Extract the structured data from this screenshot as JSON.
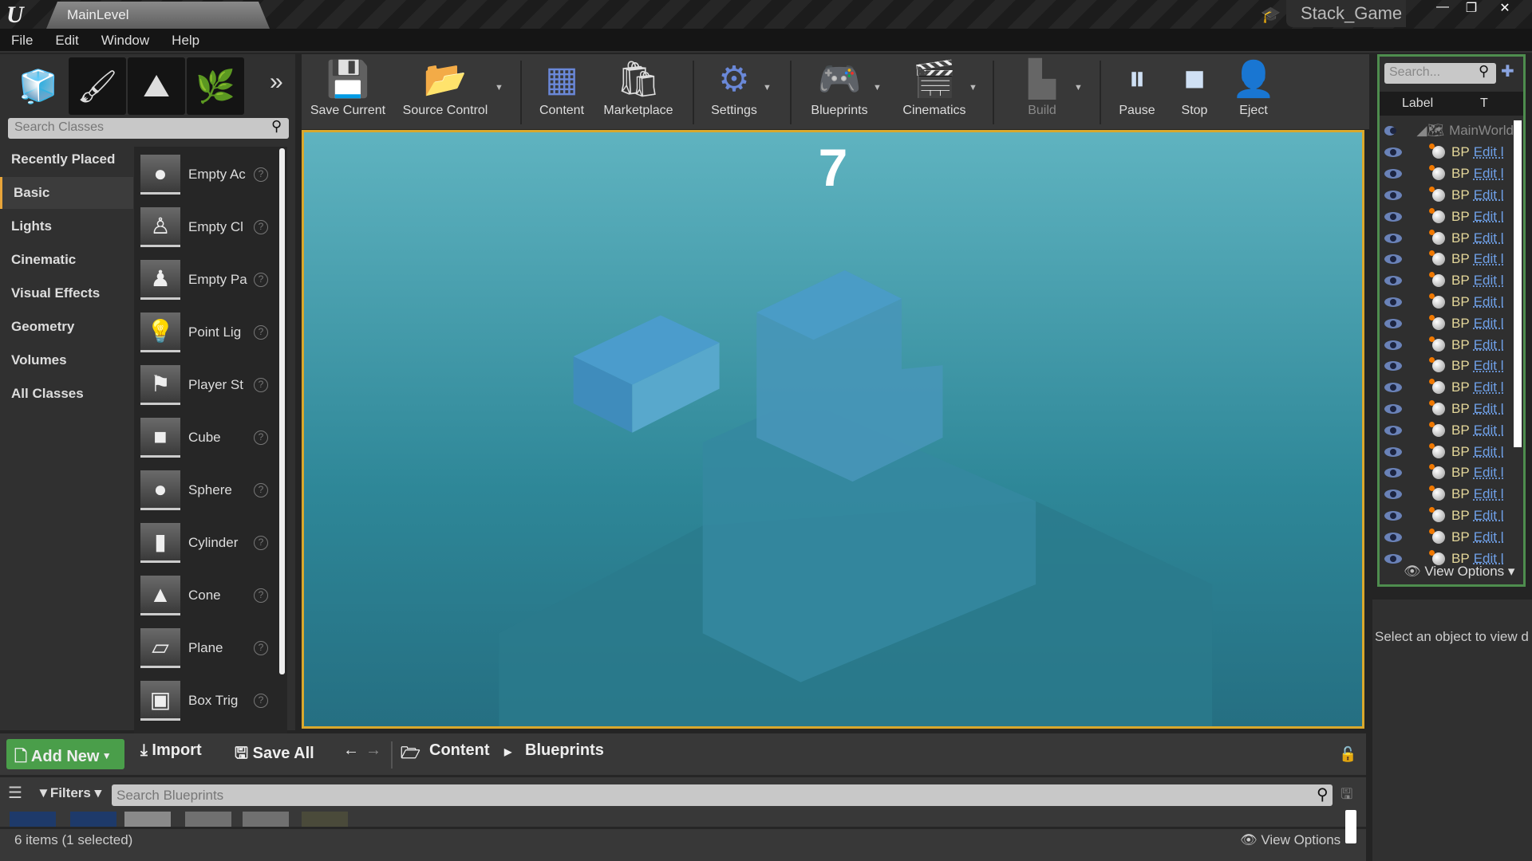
{
  "window": {
    "tab": "MainLevel",
    "project": "Stack_Game",
    "controls": [
      "—",
      "❐",
      "✕"
    ]
  },
  "menu": [
    "File",
    "Edit",
    "Window",
    "Help"
  ],
  "modes": {
    "search_placeholder": "Search Classes",
    "categories": [
      "Recently Placed",
      "Basic",
      "Lights",
      "Cinematic",
      "Visual Effects",
      "Geometry",
      "Volumes",
      "All Classes"
    ],
    "selected_category": "Basic",
    "items": [
      "Empty Ac",
      "Empty Cl",
      "Empty Pa",
      "Point Lig",
      "Player St",
      "Cube",
      "Sphere",
      "Cylinder",
      "Cone",
      "Plane",
      "Box Trig"
    ]
  },
  "toolbar": {
    "save": "Save Current",
    "source": "Source Control",
    "content": "Content",
    "marketplace": "Marketplace",
    "settings": "Settings",
    "blueprints": "Blueprints",
    "cinematics": "Cinematics",
    "build": "Build",
    "pause": "Pause",
    "stop": "Stop",
    "eject": "Eject"
  },
  "viewport": {
    "score": "7",
    "accent": "#d9a82d"
  },
  "outliner": {
    "search_placeholder": "Search...",
    "col_label": "Label",
    "col_type": "T",
    "root": "MainWorld",
    "rows": [
      {
        "label": "BP",
        "link": "Edit l"
      },
      {
        "label": "BP",
        "link": "Edit l"
      },
      {
        "label": "BP",
        "link": "Edit l"
      },
      {
        "label": "BP",
        "link": "Edit l"
      },
      {
        "label": "BP",
        "link": "Edit l"
      },
      {
        "label": "BP",
        "link": "Edit l"
      },
      {
        "label": "BP",
        "link": "Edit l"
      },
      {
        "label": "BP",
        "link": "Edit l"
      },
      {
        "label": "BP",
        "link": "Edit l"
      },
      {
        "label": "BP",
        "link": "Edit l"
      },
      {
        "label": "BP",
        "link": "Edit l"
      },
      {
        "label": "BP",
        "link": "Edit l"
      },
      {
        "label": "BP",
        "link": "Edit l"
      },
      {
        "label": "BP",
        "link": "Edit l"
      },
      {
        "label": "BP",
        "link": "Edit l"
      },
      {
        "label": "BP",
        "link": "Edit l"
      },
      {
        "label": "BP",
        "link": "Edit l"
      },
      {
        "label": "BP",
        "link": "Edit l"
      },
      {
        "label": "BP",
        "link": "Edit l"
      },
      {
        "label": "BP",
        "link": "Edit l"
      }
    ],
    "view_options": "View Options"
  },
  "details": {
    "message": "Select an object to view d"
  },
  "content_browser": {
    "add_new": "Add New",
    "import": "Import",
    "save_all": "Save All",
    "path": [
      "Content",
      "Blueprints"
    ],
    "filters": "Filters",
    "search_placeholder": "Search Blueprints",
    "status": "6 items (1 selected)",
    "view_options": "View Options",
    "add_color": "#4a9e4a"
  }
}
